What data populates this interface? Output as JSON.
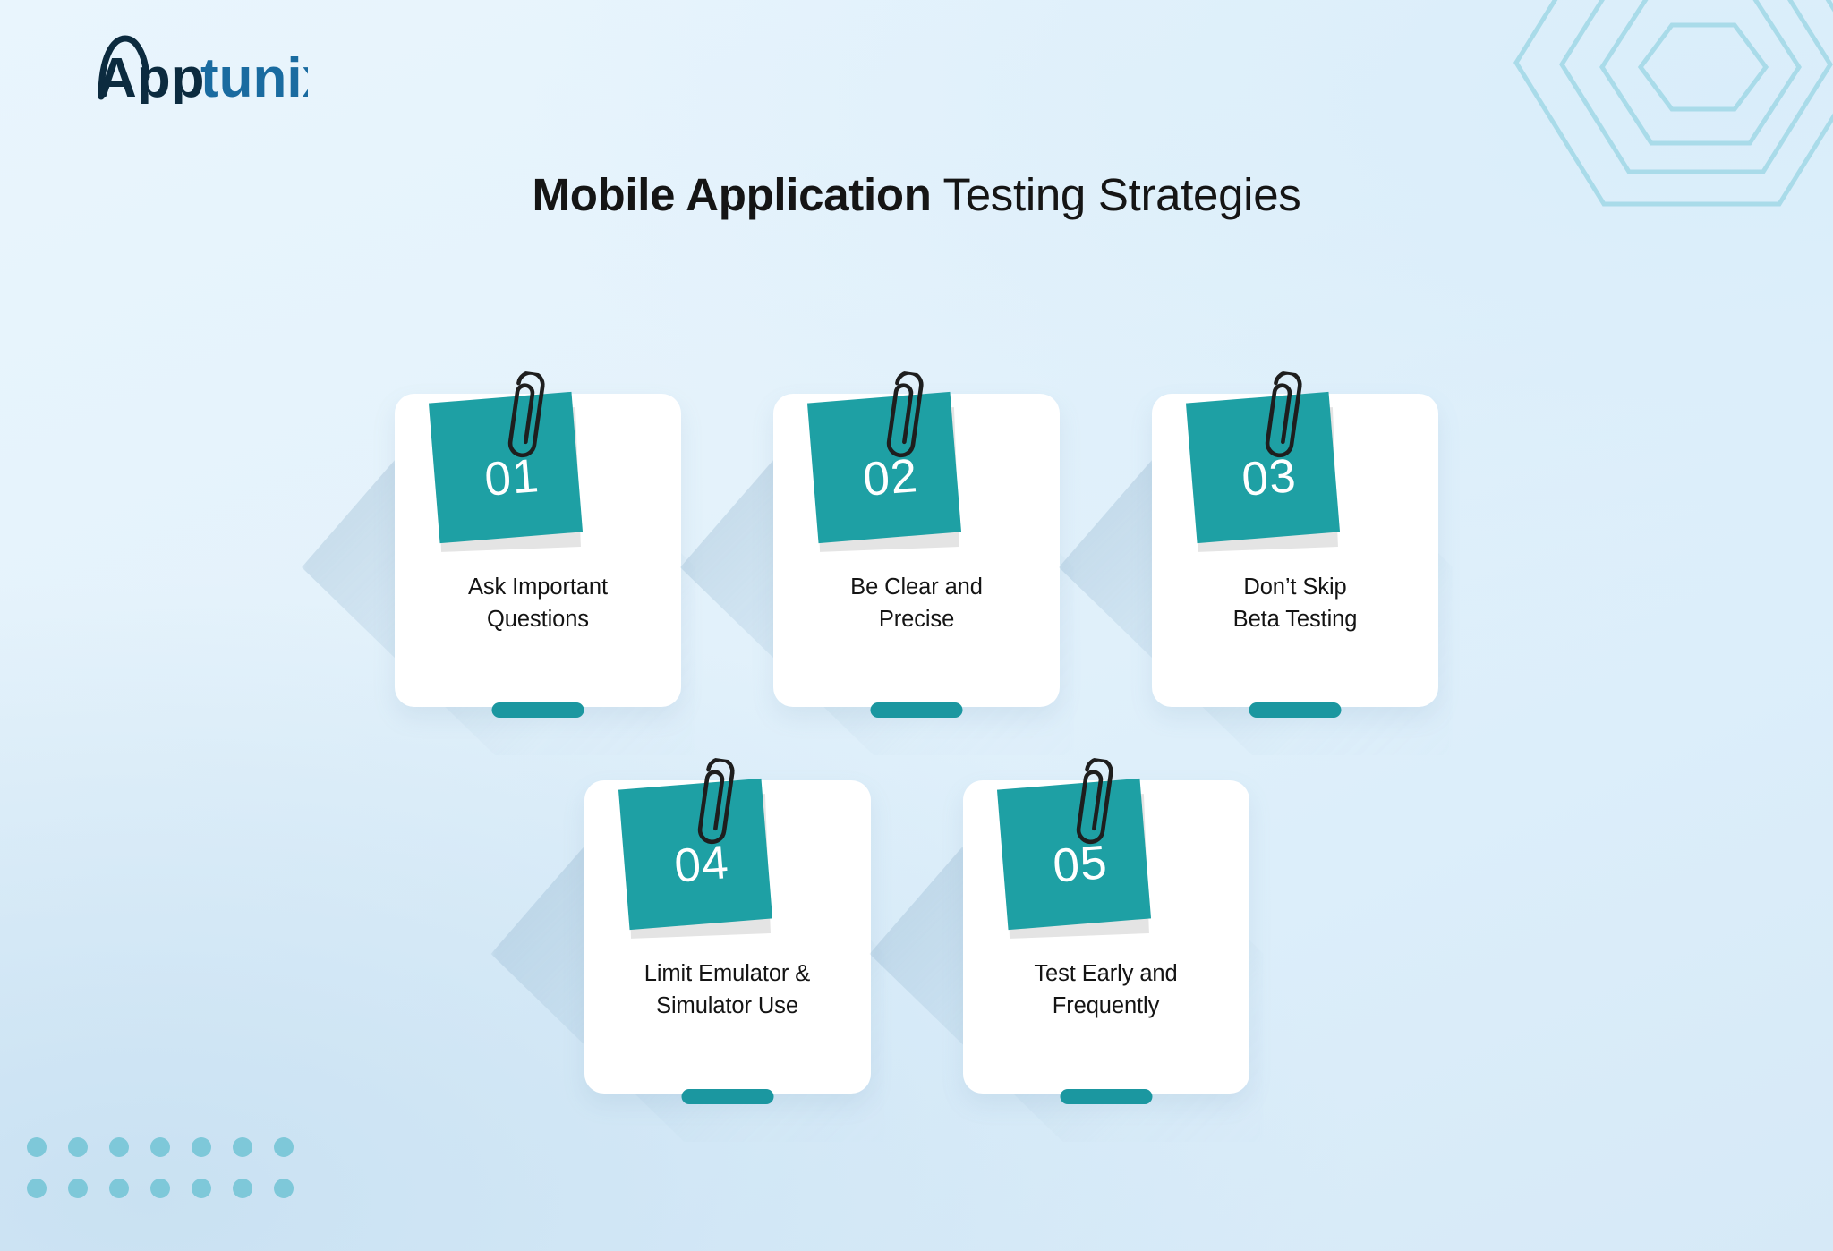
{
  "brand": {
    "logo_text_primary": "App",
    "logo_text_secondary": "tunix",
    "logo_primary_color": "#0c2b3f",
    "logo_secondary_color": "#1a6ba0",
    "accent_teal": "#1ea0a4",
    "pill_teal": "#1b97a0",
    "dot_teal": "#7ec8d9",
    "hexagon_stroke": "#a9dbe9",
    "background_from": "#e9f5fd",
    "background_to": "#d6e9f7",
    "heading_color": "#151515"
  },
  "title": {
    "strong": "Mobile Application",
    "light": " Testing Strategies"
  },
  "decor": {
    "hexagon_rings": 4,
    "dot_rows": 2,
    "dot_columns": 7
  },
  "cards": [
    {
      "number": "01",
      "caption_line1": "Ask Important",
      "caption_line2": "Questions",
      "clip_icon": "paperclip-icon"
    },
    {
      "number": "02",
      "caption_line1": "Be Clear and",
      "caption_line2": "Precise",
      "clip_icon": "paperclip-icon"
    },
    {
      "number": "03",
      "caption_line1": "Don’t Skip",
      "caption_line2": "Beta Testing",
      "clip_icon": "paperclip-icon"
    },
    {
      "number": "04",
      "caption_line1": "Limit Emulator &",
      "caption_line2": "Simulator Use",
      "clip_icon": "paperclip-icon"
    },
    {
      "number": "05",
      "caption_line1": "Test Early and",
      "caption_line2": "Frequently",
      "clip_icon": "paperclip-icon"
    }
  ]
}
